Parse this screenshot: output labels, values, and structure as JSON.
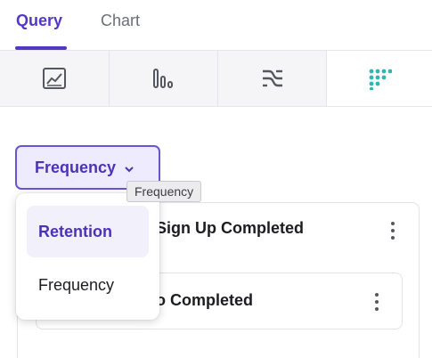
{
  "tabs": [
    {
      "label": "Query",
      "active": true
    },
    {
      "label": "Chart",
      "active": false
    }
  ],
  "chart_types": [
    {
      "icon": "line-chart-icon",
      "selected": false
    },
    {
      "icon": "bar-chart-icon",
      "selected": false
    },
    {
      "icon": "flow-chart-icon",
      "selected": false
    },
    {
      "icon": "retention-grid-icon",
      "selected": true
    }
  ],
  "selector": {
    "label": "Frequency",
    "tooltip": "Frequency"
  },
  "dropdown": {
    "items": [
      {
        "label": "Retention",
        "highlighted": true
      },
      {
        "label": "Frequency",
        "highlighted": false
      }
    ]
  },
  "events": {
    "first_title": "Sign Up Completed",
    "second_title": "o Completed"
  },
  "colors": {
    "accent": "#5338c8",
    "accent_bg": "#eeebff",
    "teal": "#2fb6b0"
  }
}
